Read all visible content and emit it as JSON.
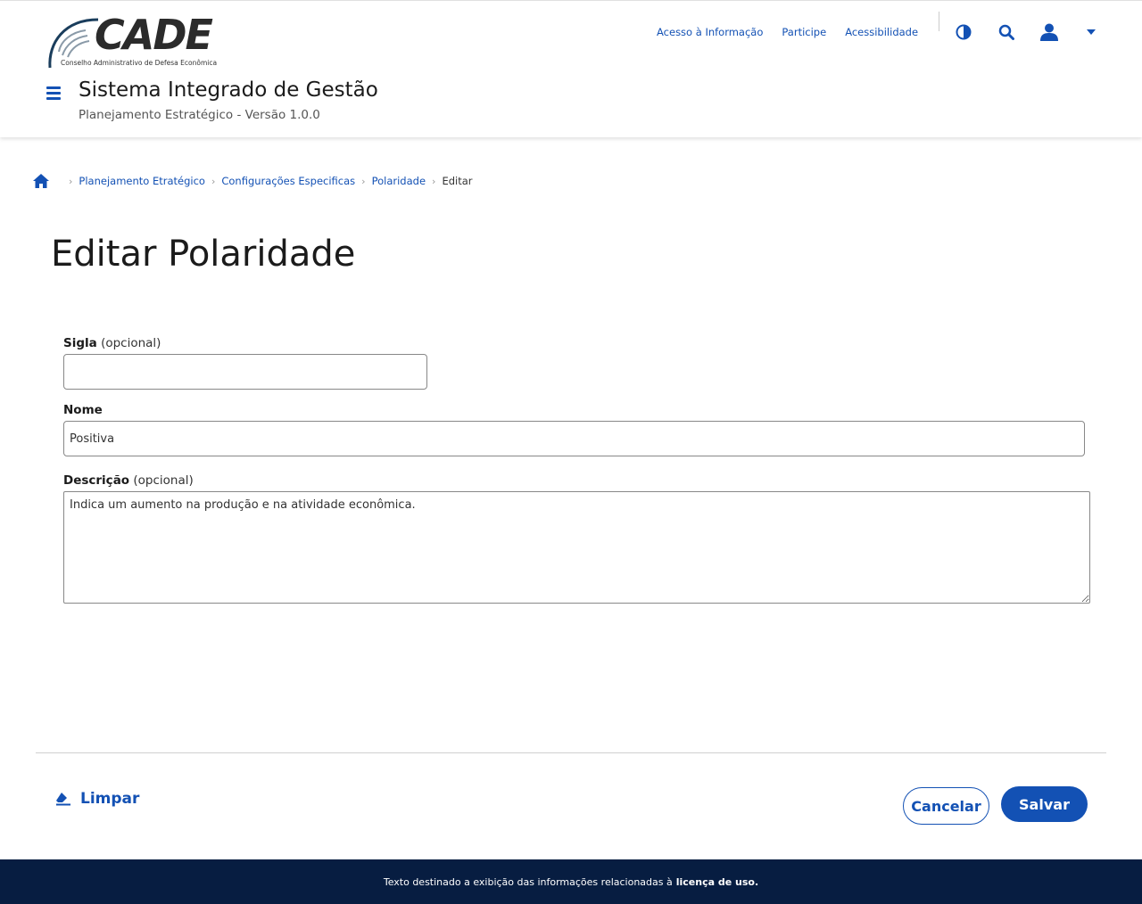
{
  "brand": {
    "logo_text": "CADE",
    "logo_subtitle": "Conselho Administrativo de Defesa Econômica",
    "primary_color": "#1351b4",
    "footer_color": "#071d41"
  },
  "header": {
    "system_title": "Sistema Integrado de Gestão",
    "system_subtitle": "Planejamento Estratégico - Versão 1.0.0",
    "links": [
      "Acesso à Informação",
      "Participe",
      "Acessibilidade"
    ],
    "icons": [
      "contrast-icon",
      "search-icon",
      "user-icon",
      "caret-down-icon"
    ]
  },
  "breadcrumb": {
    "items": [
      "Planejamento Etratégico",
      "Configurações Especificas",
      "Polaridade"
    ],
    "current": "Editar"
  },
  "page": {
    "title": "Editar Polaridade"
  },
  "form": {
    "sigla": {
      "label": "Sigla",
      "optional": "(opcional)",
      "value": ""
    },
    "nome": {
      "label": "Nome",
      "value": "Positiva"
    },
    "descricao": {
      "label": "Descrição",
      "optional": "(opcional)",
      "value": "Indica um aumento na produção e na atividade econômica."
    }
  },
  "actions": {
    "clear": "Limpar",
    "cancel": "Cancelar",
    "save": "Salvar"
  },
  "footer": {
    "text": "Texto destinado a exibição das informações relacionadas à",
    "link": "licença de uso."
  }
}
